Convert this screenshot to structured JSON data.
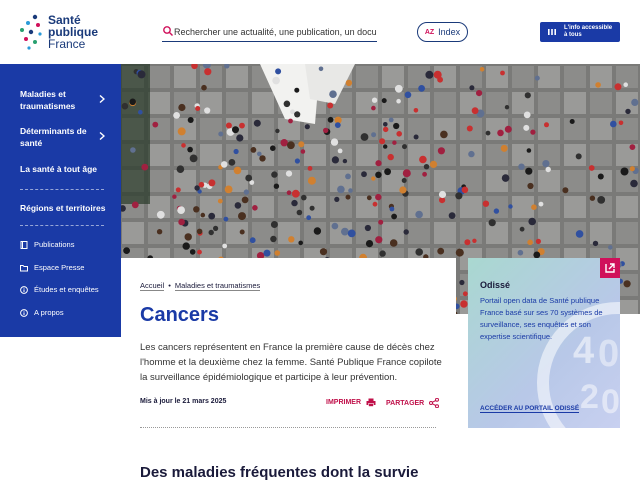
{
  "header": {
    "logo": {
      "line1": "Santé",
      "line2": "publique",
      "line3": "France"
    },
    "search": {
      "placeholder": "Rechercher une actualité, une publication, un document..."
    },
    "index_label": "Index",
    "index_az": "AZ",
    "accessibility_label_1": "L'info accessible",
    "accessibility_label_2": "à tous"
  },
  "sidebar": {
    "items": [
      {
        "label": "Maladies et traumatismes"
      },
      {
        "label": "Déterminants de santé"
      },
      {
        "label": "La santé à tout âge"
      },
      {
        "label": "Régions et territoires"
      }
    ],
    "sub_items": [
      {
        "label": "Publications",
        "icon": "book-icon"
      },
      {
        "label": "Espace Presse",
        "icon": "folder-icon"
      },
      {
        "label": "Études et enquêtes",
        "icon": "info-icon"
      },
      {
        "label": "A propos",
        "icon": "info-icon"
      }
    ]
  },
  "breadcrumb": {
    "home": "Accueil",
    "separator": "•",
    "current": "Maladies et traumatismes"
  },
  "main": {
    "title": "Cancers",
    "intro": "Les cancers représentent en France la première cause de décès chez l'homme et la deuxième chez la femme. Santé Publique France copilote la surveillance épidémiologique et participe à leur prévention.",
    "updated": "Mis à jour le 21 mars 2025",
    "print_label": "IMPRIMER",
    "share_label": "PARTAGER",
    "section_title": "Des maladies fréquentes dont la survie"
  },
  "odisse": {
    "title": "Odissé",
    "text": "Portail open data de Santé publique France basé sur ses 70 systèmes de surveillance, ses enquêtes et son expertise scientifique.",
    "link": "ACCÉDER AU PORTAIL ODISSÉ"
  },
  "colors": {
    "primary": "#1a3aa6",
    "accent": "#d0105a",
    "dark": "#1a1a3a"
  }
}
